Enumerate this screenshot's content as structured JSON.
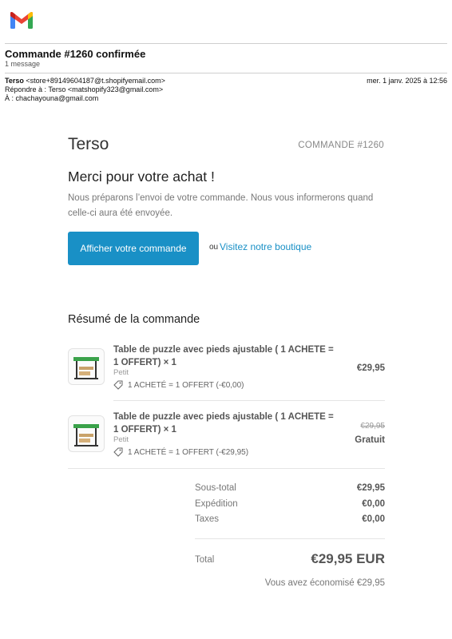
{
  "header": {
    "subject": "Commande #1260 confirmée",
    "message_count": "1 message"
  },
  "meta": {
    "from_name": "Terso",
    "from_email": "<store+89149604187@t.shopifyemail.com>",
    "reply_to": "Répondre à : Terso <matshopify323@gmail.com>",
    "to": "À : chachayouna@gmail.com",
    "date": "mer. 1 janv. 2025 à 12:56"
  },
  "email": {
    "shop_name": "Terso",
    "order_number": "COMMANDE #1260",
    "heading": "Merci pour votre achat !",
    "intro": "Nous préparons l’envoi de votre commande. Nous vous informerons quand celle-ci aura été envoyée.",
    "view_order_button": "Afficher votre commande",
    "or_text": "ou",
    "visit_shop_link": "Visitez notre boutique"
  },
  "summary": {
    "title": "Résumé de la commande",
    "items": [
      {
        "name": "Table de puzzle avec pieds ajustable ( 1 ACHETE = 1 OFFERT) × 1",
        "variant": "Petit",
        "discount": "1 ACHETÉ = 1 OFFERT (-€0,00)",
        "price": "€29,95",
        "original_price": ""
      },
      {
        "name": "Table de puzzle avec pieds ajustable ( 1 ACHETE = 1 OFFERT) × 1",
        "variant": "Petit",
        "discount": "1 ACHETÉ = 1 OFFERT (-€29,95)",
        "price": "Gratuit",
        "original_price": "€29,95"
      }
    ]
  },
  "totals": {
    "subtotal_label": "Sous-total",
    "subtotal": "€29,95",
    "shipping_label": "Expédition",
    "shipping": "€0,00",
    "taxes_label": "Taxes",
    "taxes": "€0,00",
    "total_label": "Total",
    "total": "€29,95 EUR",
    "savings": "Vous avez économisé €29,95"
  },
  "colors": {
    "accent": "#1990c6",
    "gmail_red": "#ea4335",
    "gmail_blue": "#4285f4",
    "gmail_green": "#34a853",
    "gmail_yellow": "#fbbc04"
  },
  "icons": [
    "gmail-logo-icon",
    "discount-tag-icon",
    "product-thumbnail"
  ]
}
